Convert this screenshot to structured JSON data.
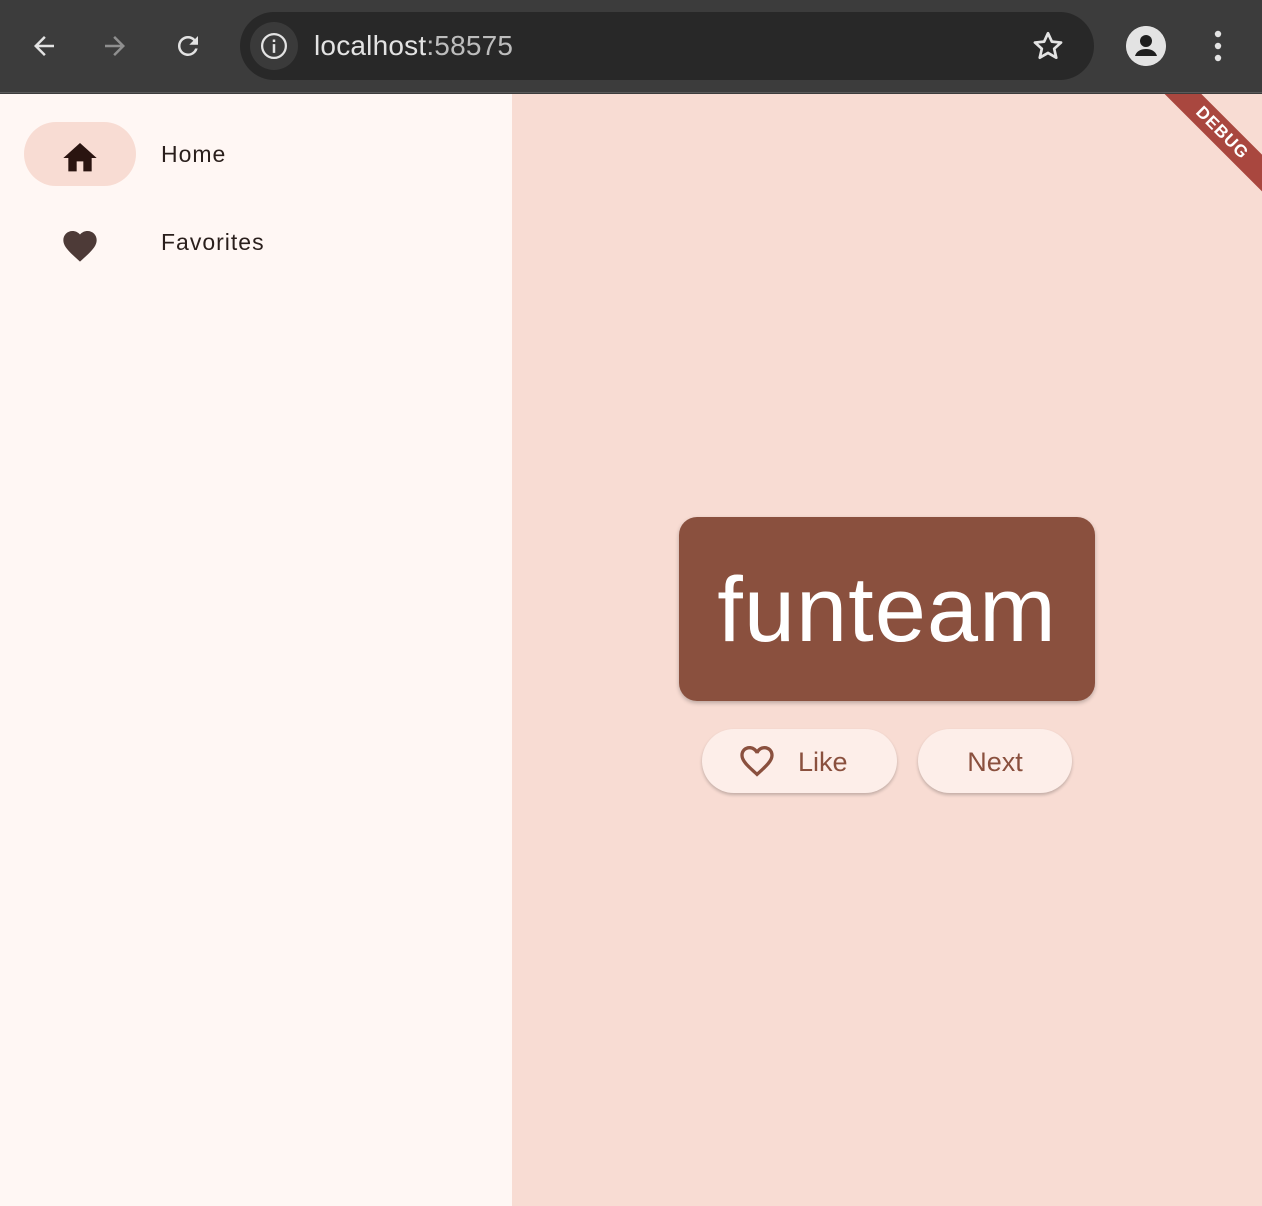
{
  "browser": {
    "url_host": "localhost",
    "url_port": ":58575",
    "icons": {
      "back": "arrow-left-icon",
      "forward": "arrow-right-icon",
      "reload": "reload-icon",
      "site_info": "info-icon",
      "bookmark": "star-icon",
      "profile": "profile-icon",
      "menu": "kebab-menu-icon"
    }
  },
  "rail": {
    "items": [
      {
        "label": "Home",
        "icon": "home-icon",
        "selected": true
      },
      {
        "label": "Favorites",
        "icon": "heart-icon",
        "selected": false
      }
    ]
  },
  "main": {
    "word": "funteam",
    "like_label": "Like",
    "next_label": "Next",
    "debug_banner": "DEBUG"
  },
  "colors": {
    "toolbar": "#3c3c3c",
    "omnibox": "#282828",
    "rail_bg": "#fff7f4",
    "content_bg": "#f8dcd3",
    "card": "#8a503e",
    "pill_bg": "#fdeee9",
    "debug": "#a9473f"
  }
}
